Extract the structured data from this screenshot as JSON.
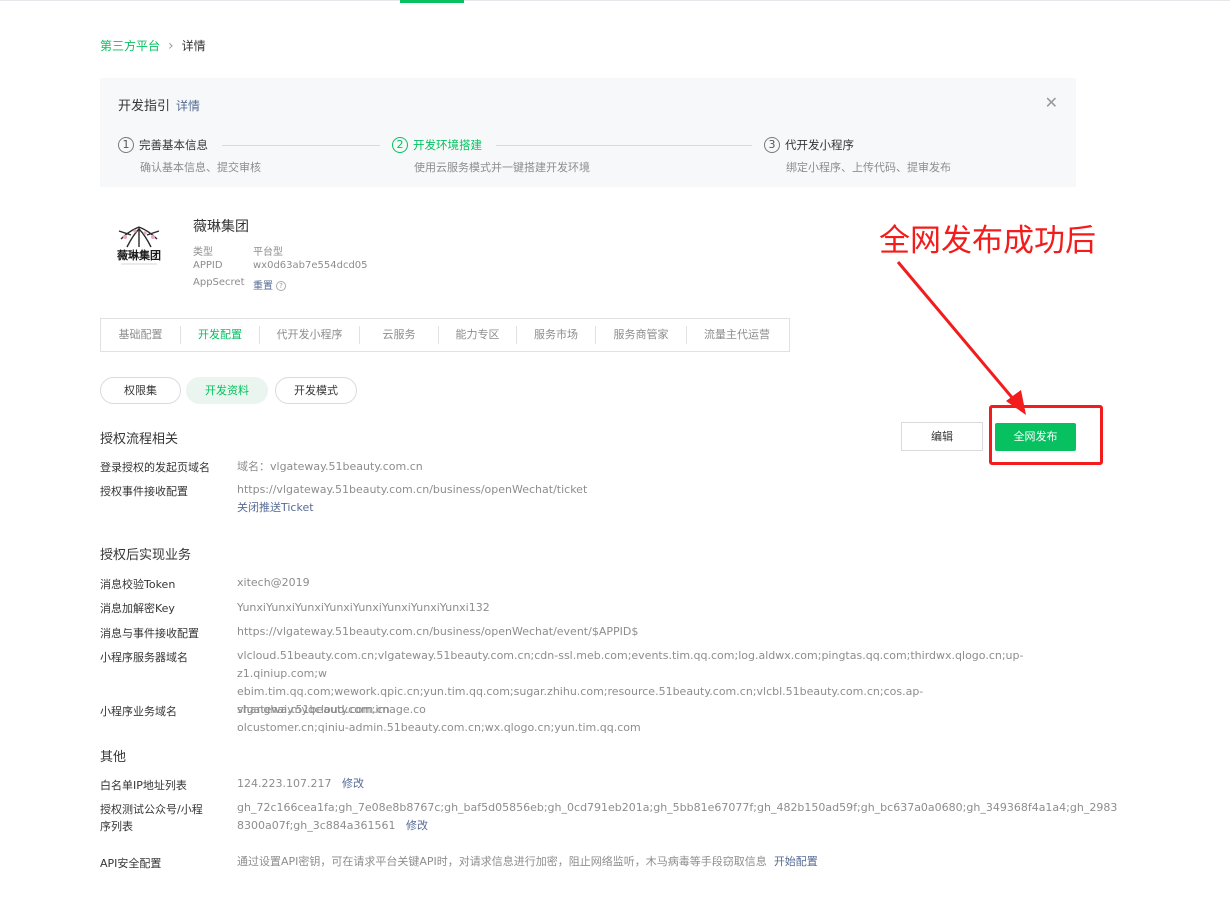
{
  "breadcrumb": {
    "parent": "第三方平台",
    "separator": "›",
    "current": "详情"
  },
  "guide": {
    "title": "开发指引",
    "detail_link": "详情",
    "close_icon": "close-icon",
    "steps": [
      {
        "num": "1",
        "name": "完善基本信息",
        "desc": "确认基本信息、提交审核",
        "active": false
      },
      {
        "num": "2",
        "name": "开发环境搭建",
        "desc": "使用云服务模式并一键搭建开发环境",
        "active": true
      },
      {
        "num": "3",
        "name": "代开发小程序",
        "desc": "绑定小程序、上传代码、提审发布",
        "active": false
      }
    ]
  },
  "account": {
    "name": "薇琳集团",
    "logo_text": "薇琳集团",
    "type_label": "类型",
    "type_value": "平台型",
    "appid_label": "APPID",
    "appid_value": "wx0d63ab7e554dcd05",
    "secret_label": "AppSecret",
    "secret_action": "重置"
  },
  "tabs": [
    "基础配置",
    "开发配置",
    "代开发小程序",
    "云服务",
    "能力专区",
    "服务市场",
    "服务商管家",
    "流量主代运营"
  ],
  "active_tab": "开发配置",
  "subtabs": [
    "权限集",
    "开发资料",
    "开发模式"
  ],
  "active_subtab": "开发资料",
  "actions": {
    "edit": "编辑",
    "publish": "全网发布"
  },
  "annotation": "全网发布成功后",
  "sections": {
    "auth_flow": {
      "title": "授权流程相关",
      "login_domain_label": "登录授权的发起页域名",
      "login_domain_value": "域名：vlgateway.51beauty.com.cn",
      "event_label": "授权事件接收配置",
      "event_value": "https://vlgateway.51beauty.com.cn/business/openWechat/ticket",
      "event_link": "关闭推送Ticket"
    },
    "business": {
      "title": "授权后实现业务",
      "token_label": "消息校验Token",
      "token_value": "xitech@2019",
      "key_label": "消息加解密Key",
      "key_value": "YunxiYunxiYunxiYunxiYunxiYunxiYunxiYunxi132",
      "msg_label": "消息与事件接收配置",
      "msg_value": "https://vlgateway.51beauty.com.cn/business/openWechat/event/$APPID$",
      "server_label": "小程序服务器域名",
      "server_lines": [
        "vlcloud.51beauty.com.cn;vlgateway.51beauty.com.cn;cdn-ssl.meb.com;events.tim.qq.com;log.aldwx.com;pingtas.qq.com;thirdwx.qlogo.cn;up-z1.qiniup.com;w",
        "ebim.tim.qq.com;wework.qpic.cn;yun.tim.qq.com;sugar.zhihu.com;resource.51beauty.com.cn;vlcbl.51beauty.com.cn;cos.ap-shanghai.myqcloud.com;image.co",
        "olcustomer.cn;qiniu-admin.51beauty.com.cn;wx.qlogo.cn;yun.tim.qq.com"
      ],
      "biz_label": "小程序业务域名",
      "biz_value": "vlgateway.51beauty.com.cn"
    },
    "other": {
      "title": "其他",
      "ip_label": "白名单IP地址列表",
      "ip_value": "124.223.107.217",
      "ip_edit": "修改",
      "test_label": "授权测试公众号/小程序列表",
      "test_lines": [
        "gh_72c166cea1fa;gh_7e08e8b8767c;gh_baf5d05856eb;gh_0cd791eb201a;gh_5bb81e67077f;gh_482b150ad59f;gh_bc637a0a0680;gh_349368f4a1a4;gh_2983",
        "8300a07f;gh_3c884a361561"
      ],
      "test_edit": "修改",
      "api_label": "API安全配置",
      "api_value": "通过设置API密钥，可在请求平台关键API时，对请求信息进行加密，阻止网络监听，木马病毒等手段窃取信息",
      "api_link": "开始配置"
    }
  },
  "colors": {
    "accent": "#07c160",
    "link": "#576b95",
    "annotation": "#f21c1c"
  }
}
